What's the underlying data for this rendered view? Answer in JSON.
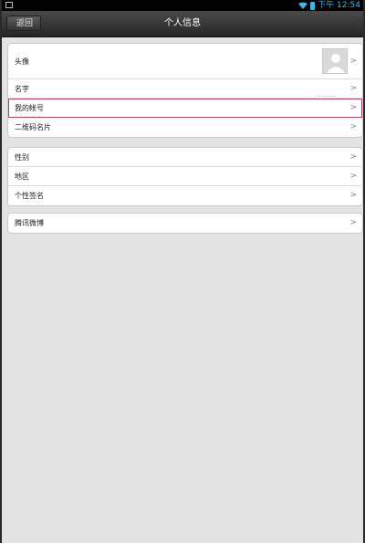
{
  "status_bar": {
    "time": "下午 12:54"
  },
  "header": {
    "back_label": "返回",
    "title": "个人信息"
  },
  "groups": [
    {
      "rows": [
        {
          "label": "头像"
        },
        {
          "label": "名字"
        },
        {
          "label": "我的帐号"
        },
        {
          "label": "二维码名片"
        }
      ]
    },
    {
      "rows": [
        {
          "label": "性别"
        },
        {
          "label": "地区"
        },
        {
          "label": "个性签名"
        }
      ]
    },
    {
      "rows": [
        {
          "label": "腾讯微博"
        }
      ]
    }
  ],
  "chevron": ">",
  "colors": {
    "background": "#e3e3e3",
    "title_bar": "#262626",
    "status_accent": "#3fb7e6",
    "highlight_border": "#b4465a"
  }
}
